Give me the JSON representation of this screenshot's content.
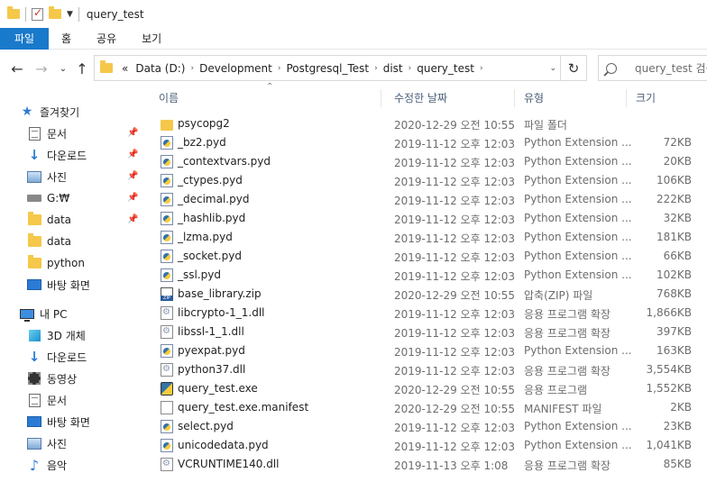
{
  "window": {
    "title": "query_test"
  },
  "ribbon": {
    "tabs": [
      "파일",
      "홈",
      "공유",
      "보기"
    ]
  },
  "address": {
    "overflow": "«",
    "crumbs": [
      "Data (D:)",
      "Development",
      "Postgresql_Test",
      "dist",
      "query_test"
    ]
  },
  "search": {
    "placeholder": "query_test 검색"
  },
  "sidebar": {
    "quick_access": {
      "label": "즐겨찾기",
      "items": [
        {
          "label": "문서",
          "icon": "document-icon",
          "pinned": true
        },
        {
          "label": "다운로드",
          "icon": "download-icon",
          "pinned": true
        },
        {
          "label": "사진",
          "icon": "pictures-icon",
          "pinned": true
        },
        {
          "label": "G:₩",
          "icon": "drive-icon",
          "pinned": true
        },
        {
          "label": "data",
          "icon": "folder-icon",
          "pinned": true
        },
        {
          "label": "data",
          "icon": "folder-icon",
          "pinned": false
        },
        {
          "label": "python",
          "icon": "folder-icon",
          "pinned": false
        },
        {
          "label": "바탕 화면",
          "icon": "desktop-icon",
          "pinned": false
        }
      ]
    },
    "this_pc": {
      "label": "내 PC",
      "items": [
        {
          "label": "3D 개체",
          "icon": "3d-objects-icon"
        },
        {
          "label": "다운로드",
          "icon": "download-icon"
        },
        {
          "label": "동영상",
          "icon": "video-icon"
        },
        {
          "label": "문서",
          "icon": "document-icon"
        },
        {
          "label": "바탕 화면",
          "icon": "desktop-icon"
        },
        {
          "label": "사진",
          "icon": "pictures-icon"
        },
        {
          "label": "음악",
          "icon": "music-icon"
        }
      ]
    }
  },
  "columns": {
    "name": "이름",
    "date": "수정한 날짜",
    "type": "유형",
    "size": "크기"
  },
  "files": [
    {
      "name": "psycopg2",
      "date": "2020-12-29 오전 10:55",
      "type": "파일 폴더",
      "size": "",
      "icon": "folder"
    },
    {
      "name": "_bz2.pyd",
      "date": "2019-11-12 오후 12:03",
      "type": "Python Extension ...",
      "size": "72KB",
      "icon": "py"
    },
    {
      "name": "_contextvars.pyd",
      "date": "2019-11-12 오후 12:03",
      "type": "Python Extension ...",
      "size": "20KB",
      "icon": "py"
    },
    {
      "name": "_ctypes.pyd",
      "date": "2019-11-12 오후 12:03",
      "type": "Python Extension ...",
      "size": "106KB",
      "icon": "py"
    },
    {
      "name": "_decimal.pyd",
      "date": "2019-11-12 오후 12:03",
      "type": "Python Extension ...",
      "size": "222KB",
      "icon": "py"
    },
    {
      "name": "_hashlib.pyd",
      "date": "2019-11-12 오후 12:03",
      "type": "Python Extension ...",
      "size": "32KB",
      "icon": "py"
    },
    {
      "name": "_lzma.pyd",
      "date": "2019-11-12 오후 12:03",
      "type": "Python Extension ...",
      "size": "181KB",
      "icon": "py"
    },
    {
      "name": "_socket.pyd",
      "date": "2019-11-12 오후 12:03",
      "type": "Python Extension ...",
      "size": "66KB",
      "icon": "py"
    },
    {
      "name": "_ssl.pyd",
      "date": "2019-11-12 오후 12:03",
      "type": "Python Extension ...",
      "size": "102KB",
      "icon": "py"
    },
    {
      "name": "base_library.zip",
      "date": "2020-12-29 오전 10:55",
      "type": "압축(ZIP) 파일",
      "size": "768KB",
      "icon": "zip"
    },
    {
      "name": "libcrypto-1_1.dll",
      "date": "2019-11-12 오후 12:03",
      "type": "응용 프로그램 확장",
      "size": "1,866KB",
      "icon": "dll"
    },
    {
      "name": "libssl-1_1.dll",
      "date": "2019-11-12 오후 12:03",
      "type": "응용 프로그램 확장",
      "size": "397KB",
      "icon": "dll"
    },
    {
      "name": "pyexpat.pyd",
      "date": "2019-11-12 오후 12:03",
      "type": "Python Extension ...",
      "size": "163KB",
      "icon": "py"
    },
    {
      "name": "python37.dll",
      "date": "2019-11-12 오후 12:03",
      "type": "응용 프로그램 확장",
      "size": "3,554KB",
      "icon": "dll"
    },
    {
      "name": "query_test.exe",
      "date": "2020-12-29 오전 10:55",
      "type": "응용 프로그램",
      "size": "1,552KB",
      "icon": "exe"
    },
    {
      "name": "query_test.exe.manifest",
      "date": "2020-12-29 오전 10:55",
      "type": "MANIFEST 파일",
      "size": "2KB",
      "icon": "manifest"
    },
    {
      "name": "select.pyd",
      "date": "2019-11-12 오후 12:03",
      "type": "Python Extension ...",
      "size": "23KB",
      "icon": "py"
    },
    {
      "name": "unicodedata.pyd",
      "date": "2019-11-12 오후 12:03",
      "type": "Python Extension ...",
      "size": "1,041KB",
      "icon": "py"
    },
    {
      "name": "VCRUNTIME140.dll",
      "date": "2019-11-13 오후 1:08",
      "type": "응용 프로그램 확장",
      "size": "85KB",
      "icon": "dll"
    }
  ]
}
